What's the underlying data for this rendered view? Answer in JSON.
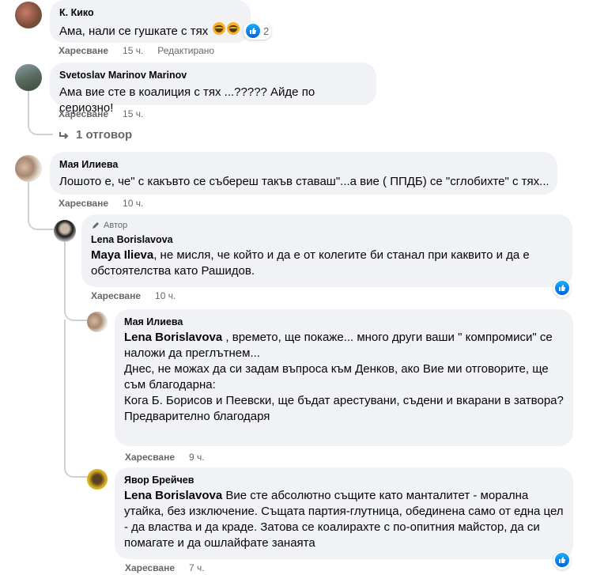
{
  "like_label": "Харесване",
  "comments": [
    {
      "author": "К. Кико",
      "text": "Ама, нали се гушкате с тях",
      "reaction_count": "2",
      "time": "15 ч.",
      "edited": "Редактирано"
    },
    {
      "author": "Svetoslav Marinov Marinov",
      "text": "Ама вие сте в коалиция с тях ...????? Айде по сериозно!",
      "time": "15 ч.",
      "replies_link": "1 отговор"
    },
    {
      "author": "Мая Илиева",
      "text": "Лошото е, че\" с какъвто се събереш такъв ставаш\"...а вие ( ППДБ) се \"сглобихте\" с тях...",
      "time": "10 ч."
    }
  ],
  "replies": [
    {
      "badge": "Автор",
      "author": "Lena Borislavova",
      "mention": "Maya Ilieva",
      "text": ", не мисля, че който и да е от колегите би станал при каквито и да е обстоятелства като Рашидов.",
      "time": "10 ч."
    },
    {
      "author": "Мая Илиева",
      "mention": "Lena Borislavova",
      "text_lines": [
        " , времето, ще покаже... много други ваши \" компромиси\" се наложи да преглътнем...",
        "Днес, не можах да си задам въпроса към Денков, ако Вие ми отговорите, ще съм благодарна:",
        "Кога Б. Борисов и Пеевски, ще бъдат арестувани, съдени и вкарани в затвора?",
        "Предварително благодаря"
      ],
      "time": "9 ч."
    },
    {
      "author": "Явор Брейчев",
      "mention": "Lena Borislavova",
      "text": " Вие сте абсолютно същите като манталитет - морална утайка, без изключение. Същата партия-глутница, обединена само от една цел - да властва и да краде. Затова се коалирахте с по-опитния майстор, да си помагате и да ошлайфате занаята",
      "time": "7 ч."
    }
  ],
  "colors": {
    "bubble": "#f0f2f5",
    "meta": "#65676b",
    "like": "#1877f2",
    "thread_line": "#ced0d4"
  }
}
